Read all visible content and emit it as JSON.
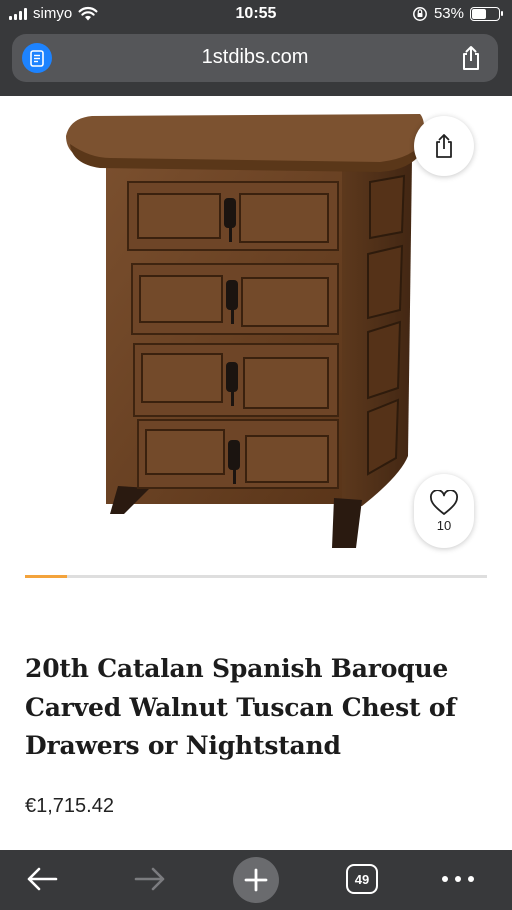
{
  "status_bar": {
    "carrier": "simyo",
    "time": "10:55",
    "battery_percent": "53%",
    "battery_level": 0.53,
    "icons": [
      "signal-icon",
      "wifi-icon",
      "orientation-lock-icon",
      "battery-icon"
    ]
  },
  "browser": {
    "url": "1stdibs.com",
    "tab_count": "49",
    "icons": [
      "reader-mode-icon",
      "share-icon",
      "back-icon",
      "forward-icon",
      "new-tab-icon",
      "tabs-icon",
      "more-icon"
    ]
  },
  "product": {
    "title": "20th Catalan Spanish Baroque Carved Walnut Tuscan Chest of Drawers or Nightstand",
    "price": "€1,715.42",
    "favorites_count": "10",
    "gallery_progress": 0.09
  },
  "colors": {
    "chrome": "#38393b",
    "url_bar": "#555659",
    "reader_button": "#1d83ff",
    "progress_accent": "#f3a33c",
    "wood": "#6a4327"
  }
}
